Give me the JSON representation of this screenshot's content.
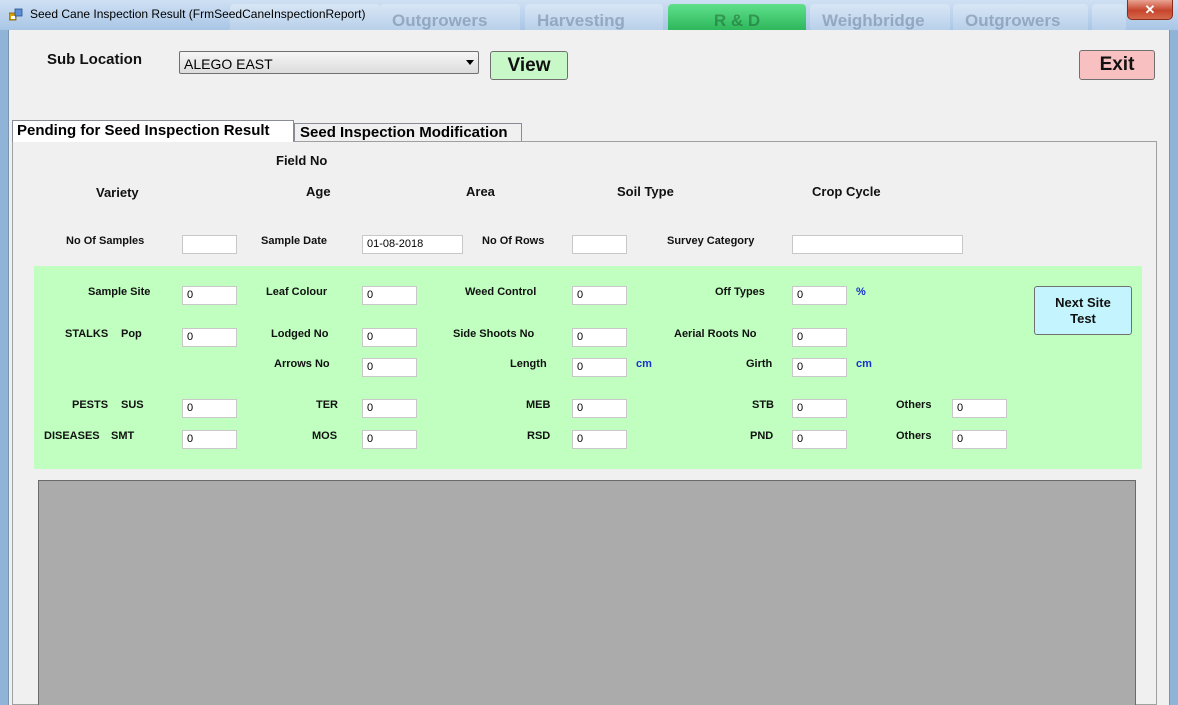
{
  "window": {
    "title": "Seed Cane Inspection Result (FrmSeedCaneInspectionReport)"
  },
  "background_tabs": [
    "Outgrowers",
    "Harvesting",
    "R & D",
    "Weighbridge",
    "Outgrowers"
  ],
  "header": {
    "sub_location_label": "Sub Location",
    "sub_location_value": "ALEGO EAST",
    "view_label": "View",
    "exit_label": "Exit"
  },
  "tabs": [
    {
      "label": "Pending for Seed Inspection Result",
      "active": true
    },
    {
      "label": "Seed Inspection Modification",
      "active": false
    }
  ],
  "info": {
    "field_no": "Field No",
    "variety": "Variety",
    "age": "Age",
    "area": "Area",
    "soil_type": "Soil Type",
    "crop_cycle": "Crop Cycle"
  },
  "sample": {
    "no_of_samples_label": "No Of Samples",
    "no_of_samples_value": "",
    "sample_date_label": "Sample Date",
    "sample_date_value": "01-08-2018",
    "no_of_rows_label": "No Of Rows",
    "no_of_rows_value": "",
    "survey_category_label": "Survey Category",
    "survey_category_value": ""
  },
  "site": {
    "sample_site_label": "Sample Site",
    "sample_site_value": "0",
    "leaf_colour_label": "Leaf Colour",
    "leaf_colour_value": "0",
    "weed_control_label": "Weed Control",
    "weed_control_value": "0",
    "off_types_label": "Off Types",
    "off_types_value": "0",
    "off_types_unit": "%",
    "next_site_label": "Next Site Test"
  },
  "stalks": {
    "group_label": "STALKS",
    "pop_label": "Pop",
    "pop_value": "0",
    "lodged_label": "Lodged No",
    "lodged_value": "0",
    "side_shoots_label": "Side Shoots No",
    "side_shoots_value": "0",
    "aerial_roots_label": "Aerial Roots No",
    "aerial_roots_value": "0",
    "arrows_label": "Arrows No",
    "arrows_value": "0",
    "length_label": "Length",
    "length_value": "0",
    "length_unit": "cm",
    "girth_label": "Girth",
    "girth_value": "0",
    "girth_unit": "cm"
  },
  "pests": {
    "group_label": "PESTS",
    "sus_label": "SUS",
    "sus_value": "0",
    "ter_label": "TER",
    "ter_value": "0",
    "meb_label": "MEB",
    "meb_value": "0",
    "stb_label": "STB",
    "stb_value": "0",
    "others_label": "Others",
    "others_value": "0"
  },
  "diseases": {
    "group_label": "DISEASES",
    "smt_label": "SMT",
    "smt_value": "0",
    "mos_label": "MOS",
    "mos_value": "0",
    "rsd_label": "RSD",
    "rsd_value": "0",
    "pnd_label": "PND",
    "pnd_value": "0",
    "others_label": "Others",
    "others_value": "0"
  },
  "colors": {
    "panel_green": "#c0ffc0",
    "view_button": "#c8f7c8",
    "exit_button": "#f8c0c0",
    "next_site_button": "#c4f5ff",
    "unit_blue": "#1a2fd0",
    "grid_gray": "#ababab"
  }
}
